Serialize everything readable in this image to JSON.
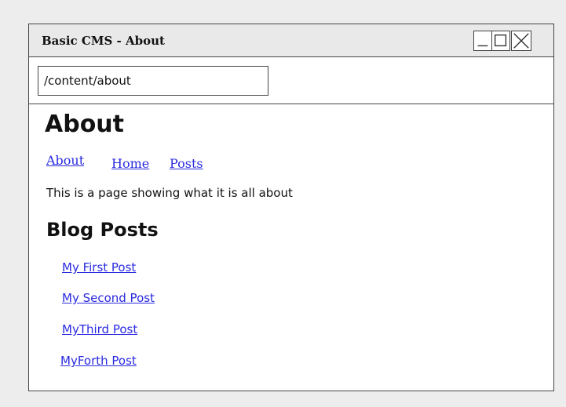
{
  "window": {
    "title": "Basic CMS - About"
  },
  "address_bar": {
    "value": "/content/about"
  },
  "page": {
    "title": "About",
    "nav": [
      {
        "label": "About"
      },
      {
        "label": "Home"
      },
      {
        "label": "Posts"
      }
    ],
    "description": "This is a page showing what it is all about",
    "section_title": "Blog Posts",
    "posts": [
      {
        "label": "My First Post"
      },
      {
        "label": "My Second Post"
      },
      {
        "label": "MyThird Post"
      },
      {
        "label": "MyForth Post"
      }
    ]
  },
  "colors": {
    "link": "#2a2ae0",
    "background": "#ededed",
    "titlebar": "#e9e9e9"
  },
  "icons": {
    "minimize": "minimize-icon",
    "maximize": "maximize-icon",
    "close": "close-icon"
  }
}
